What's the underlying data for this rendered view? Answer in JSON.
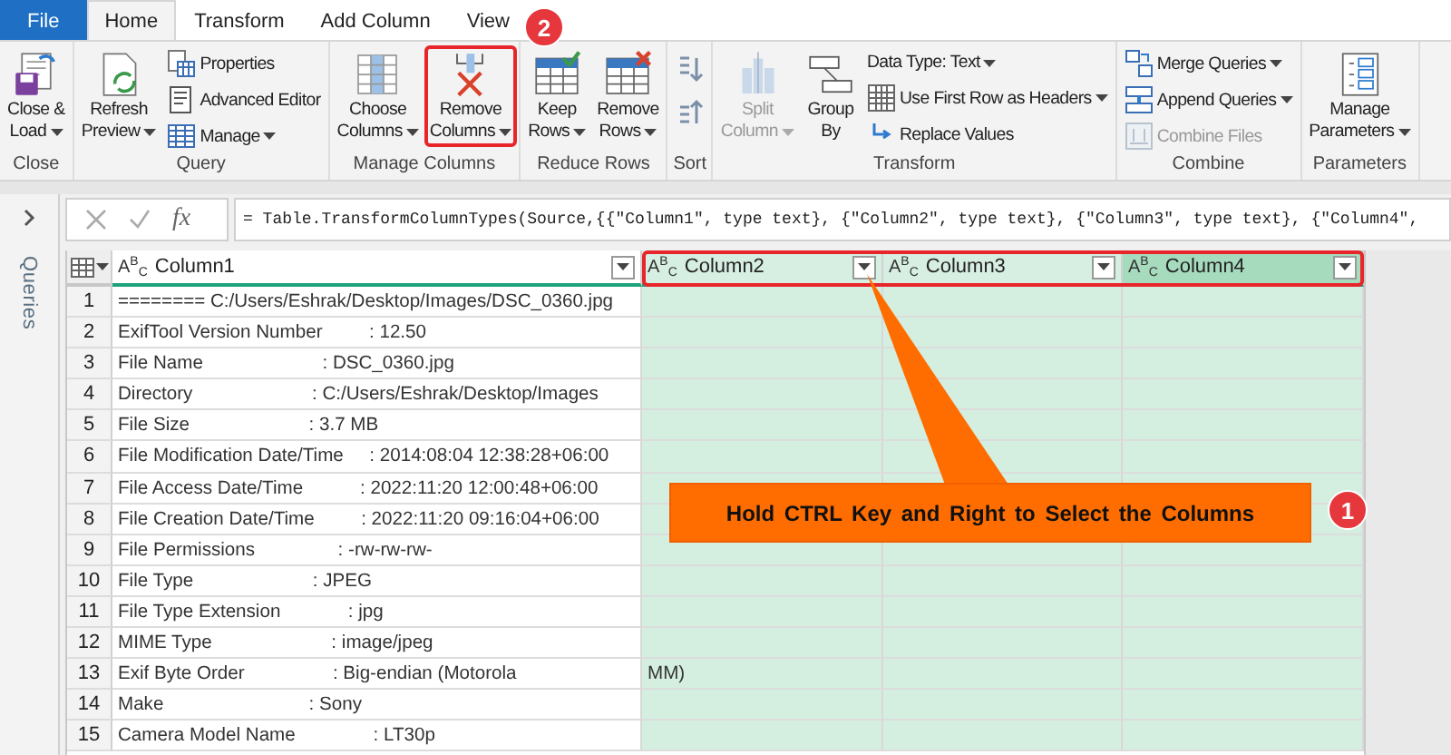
{
  "tabs": [
    {
      "label": "File",
      "kind": "file",
      "selected": false
    },
    {
      "label": "Home",
      "kind": "tab",
      "selected": true
    },
    {
      "label": "Transform",
      "kind": "tab",
      "selected": false
    },
    {
      "label": "Add Column",
      "kind": "tab",
      "selected": false
    },
    {
      "label": "View",
      "kind": "tab",
      "selected": false
    }
  ],
  "ribbon": {
    "groups": [
      {
        "label": "Close",
        "items": [
          {
            "kind": "large",
            "lines": [
              "Close &",
              "Load"
            ],
            "dropdown": true,
            "disabled": false,
            "highlighted": false
          }
        ]
      },
      {
        "label": "Query",
        "items": [
          {
            "kind": "large",
            "lines": [
              "Refresh",
              "Preview"
            ],
            "dropdown": true,
            "disabled": false,
            "highlighted": false
          },
          {
            "kind": "small",
            "lines": [
              "Properties"
            ],
            "dropdown": false,
            "disabled": false,
            "highlighted": false
          },
          {
            "kind": "small",
            "lines": [
              "Advanced Editor"
            ],
            "dropdown": false,
            "disabled": false,
            "highlighted": false
          },
          {
            "kind": "small",
            "lines": [
              "Manage"
            ],
            "dropdown": true,
            "disabled": false,
            "highlighted": false
          }
        ]
      },
      {
        "label": "Manage Columns",
        "items": [
          {
            "kind": "large",
            "lines": [
              "Choose",
              "Columns"
            ],
            "dropdown": true,
            "disabled": false,
            "highlighted": false
          },
          {
            "kind": "large",
            "lines": [
              "Remove",
              "Columns"
            ],
            "dropdown": true,
            "disabled": false,
            "highlighted": true
          }
        ]
      },
      {
        "label": "Reduce Rows",
        "items": [
          {
            "kind": "large",
            "lines": [
              "Keep",
              "Rows"
            ],
            "dropdown": true,
            "disabled": false,
            "highlighted": false
          },
          {
            "kind": "large",
            "lines": [
              "Remove",
              "Rows"
            ],
            "dropdown": true,
            "disabled": false,
            "highlighted": false
          }
        ]
      },
      {
        "label": "Sort",
        "items": [
          {
            "kind": "icon",
            "disabled": false,
            "highlighted": false
          },
          {
            "kind": "icon",
            "disabled": false,
            "highlighted": false
          }
        ]
      },
      {
        "label": "Transform",
        "items": [
          {
            "kind": "large",
            "lines": [
              "Split",
              "Column"
            ],
            "dropdown": true,
            "disabled": true,
            "highlighted": false
          },
          {
            "kind": "large",
            "lines": [
              "Group",
              "By"
            ],
            "dropdown": false,
            "disabled": false,
            "highlighted": false
          },
          {
            "kind": "small",
            "lines": [
              "Data Type: Text"
            ],
            "dropdown": true,
            "disabled": false,
            "highlighted": false
          },
          {
            "kind": "small",
            "lines": [
              "Use First Row as Headers"
            ],
            "dropdown": true,
            "disabled": false,
            "highlighted": false
          },
          {
            "kind": "small",
            "lines": [
              "Replace Values"
            ],
            "dropdown": false,
            "disabled": false,
            "highlighted": false
          }
        ]
      },
      {
        "label": "Combine",
        "items": [
          {
            "kind": "small",
            "lines": [
              "Merge Queries"
            ],
            "dropdown": true,
            "disabled": false,
            "highlighted": false
          },
          {
            "kind": "small",
            "lines": [
              "Append Queries"
            ],
            "dropdown": true,
            "disabled": false,
            "highlighted": false
          },
          {
            "kind": "small",
            "lines": [
              "Combine Files"
            ],
            "dropdown": false,
            "disabled": true,
            "highlighted": false
          }
        ]
      },
      {
        "label": "Parameters",
        "items": [
          {
            "kind": "large",
            "lines": [
              "Manage",
              "Parameters"
            ],
            "dropdown": true,
            "disabled": false,
            "highlighted": false
          }
        ]
      }
    ]
  },
  "queries_pane": {
    "label": "Queries"
  },
  "formula_bar": {
    "fx": "fx",
    "formula": "= Table.TransformColumnTypes(Source,{{\"Column1\", type text}, {\"Column2\", type text}, {\"Column3\", type text}, {\"Column4\","
  },
  "table": {
    "columns": [
      {
        "type": "A$^{B}$$_{C}$",
        "name": "Column1",
        "selected": false,
        "current": false,
        "outlined": false
      },
      {
        "type": "A$^{B}$$_{C}$",
        "name": "Column2",
        "selected": true,
        "current": false,
        "outlined": true
      },
      {
        "type": "A$^{B}$$_{C}$",
        "name": "Column3",
        "selected": true,
        "current": false,
        "outlined": true
      },
      {
        "type": "A$^{B}$$_{C}$",
        "name": "Column4",
        "selected": true,
        "current": true,
        "outlined": true
      }
    ],
    "rows": [
      {
        "number": "1",
        "cells": [
          "======== C:/Users/Eshrak/Desktop/Images/DSC_0360.jpg",
          "",
          "",
          ""
        ]
      },
      {
        "number": "2",
        "cells": [
          "ExifTool Version Number         : 12.50",
          "",
          "",
          ""
        ]
      },
      {
        "number": "3",
        "cells": [
          "File Name                       : DSC_0360.jpg",
          "",
          "",
          ""
        ]
      },
      {
        "number": "4",
        "cells": [
          "Directory                       : C:/Users/Eshrak/Desktop/Images",
          "",
          "",
          ""
        ]
      },
      {
        "number": "5",
        "cells": [
          "File Size                       : 3.7 MB",
          "",
          "",
          ""
        ]
      },
      {
        "number": "6",
        "cells": [
          "File Modification Date/Time     : 2014:08:04 12:38:28+06:00",
          "",
          "",
          ""
        ]
      },
      {
        "number": "7",
        "cells": [
          "File Access Date/Time           : 2022:11:20 12:00:48+06:00",
          "",
          "",
          ""
        ]
      },
      {
        "number": "8",
        "cells": [
          "File Creation Date/Time         : 2022:11:20 09:16:04+06:00",
          "",
          "",
          ""
        ]
      },
      {
        "number": "9",
        "cells": [
          "File Permissions                : -rw-rw-rw-",
          "",
          "",
          ""
        ]
      },
      {
        "number": "10",
        "cells": [
          "File Type                       : JPEG",
          "",
          "",
          ""
        ]
      },
      {
        "number": "11",
        "cells": [
          "File Type Extension             : jpg",
          "",
          "",
          ""
        ]
      },
      {
        "number": "12",
        "cells": [
          "MIME Type                       : image/jpeg",
          "",
          "",
          ""
        ]
      },
      {
        "number": "13",
        "cells": [
          "Exif Byte Order                 : Big-endian (Motorola",
          "MM)",
          "",
          ""
        ]
      },
      {
        "number": "14",
        "cells": [
          "Make                            : Sony",
          "",
          "",
          ""
        ]
      },
      {
        "number": "15",
        "cells": [
          "Camera Model Name               : LT30p",
          "",
          "",
          ""
        ]
      }
    ]
  },
  "annotations": {
    "callout": "Hold CTRL Key and Right to Select the Columns",
    "badges": [
      "1",
      "2"
    ]
  }
}
